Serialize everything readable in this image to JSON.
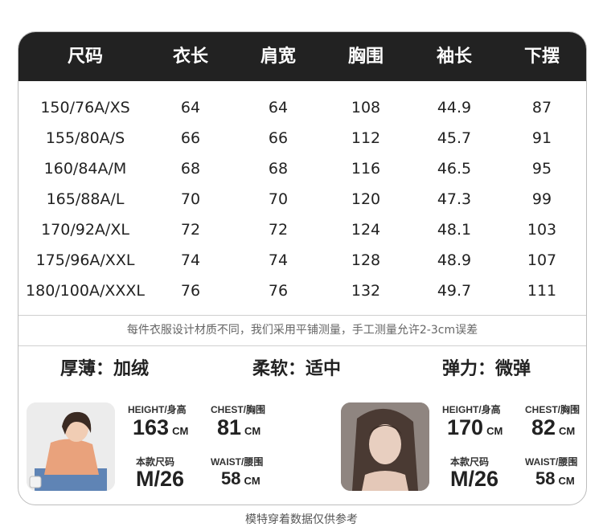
{
  "table": {
    "headers": [
      "尺码",
      "衣长",
      "肩宽",
      "胸围",
      "袖长",
      "下摆"
    ],
    "rows": [
      [
        "150/76A/XS",
        "64",
        "64",
        "108",
        "44.9",
        "87"
      ],
      [
        "155/80A/S",
        "66",
        "66",
        "112",
        "45.7",
        "91"
      ],
      [
        "160/84A/M",
        "68",
        "68",
        "116",
        "46.5",
        "95"
      ],
      [
        "165/88A/L",
        "70",
        "70",
        "120",
        "47.3",
        "99"
      ],
      [
        "170/92A/XL",
        "72",
        "72",
        "124",
        "48.1",
        "103"
      ],
      [
        "175/96A/XXL",
        "74",
        "74",
        "128",
        "48.9",
        "107"
      ],
      [
        "180/100A/XXXL",
        "76",
        "76",
        "132",
        "49.7",
        "111"
      ]
    ]
  },
  "note": "每件衣服设计材质不同，我们采用平铺测量，手工测量允许2-3cm误差",
  "attributes": {
    "thickness": "厚薄：加绒",
    "softness": "柔软：适中",
    "elasticity": "弹力：微弹"
  },
  "models": [
    {
      "height_label": "HEIGHT/身高",
      "height_value": "163",
      "chest_label": "CHEST/胸围",
      "chest_value": "81",
      "size_label": "本款尺码",
      "size_value": "M/26",
      "waist_label": "WAIST/腰围",
      "waist_value": "58",
      "unit": "CM"
    },
    {
      "height_label": "HEIGHT/身高",
      "height_value": "170",
      "chest_label": "CHEST/胸围",
      "chest_value": "82",
      "size_label": "本款尺码",
      "size_value": "M/26",
      "waist_label": "WAIST/腰围",
      "waist_value": "58",
      "unit": "CM"
    }
  ],
  "footer": "模特穿着数据仅供参考"
}
